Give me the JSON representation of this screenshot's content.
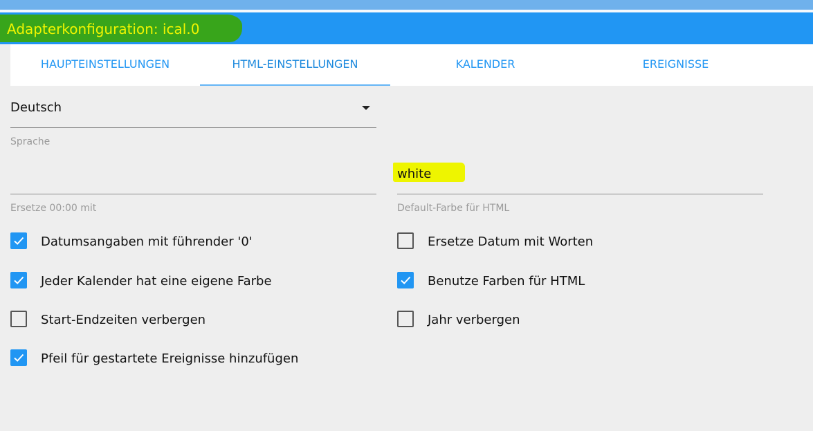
{
  "window": {
    "title": "Adapterkonfiguration: ical.0"
  },
  "tabs": [
    {
      "label": "HAUPTEINSTELLUNGEN",
      "active": false
    },
    {
      "label": "HTML-EINSTELLUNGEN",
      "active": true
    },
    {
      "label": "KALENDER",
      "active": false
    },
    {
      "label": "EREIGNISSE",
      "active": false
    }
  ],
  "fields": {
    "language": {
      "value": "Deutsch",
      "helper": "Sprache"
    },
    "replace_midnight": {
      "value": "",
      "helper": "Ersetze 00:00 mit"
    },
    "default_color": {
      "value": "white",
      "helper": "Default-Farbe für HTML"
    }
  },
  "checkboxes": {
    "left": [
      {
        "label": "Datumsangaben mit führender '0'",
        "checked": true
      },
      {
        "label": "Jeder Kalender hat eine eigene Farbe",
        "checked": true
      },
      {
        "label": "Start-Endzeiten verbergen",
        "checked": false
      },
      {
        "label": "Pfeil für gestartete Ereignisse hinzufügen",
        "checked": true
      }
    ],
    "right": [
      {
        "label": "Ersetze Datum mit Worten",
        "checked": false
      },
      {
        "label": "Benutze Farben für HTML",
        "checked": true
      },
      {
        "label": "Jahr verbergen",
        "checked": false
      }
    ]
  },
  "icons": {
    "dropdown": "caret-down-icon",
    "checkbox_checked": "checkmark-icon"
  },
  "colors": {
    "accent": "#2196f3",
    "title_highlight": "#38a51b",
    "title_text": "#f0f500",
    "value_highlight": "#eef500"
  }
}
